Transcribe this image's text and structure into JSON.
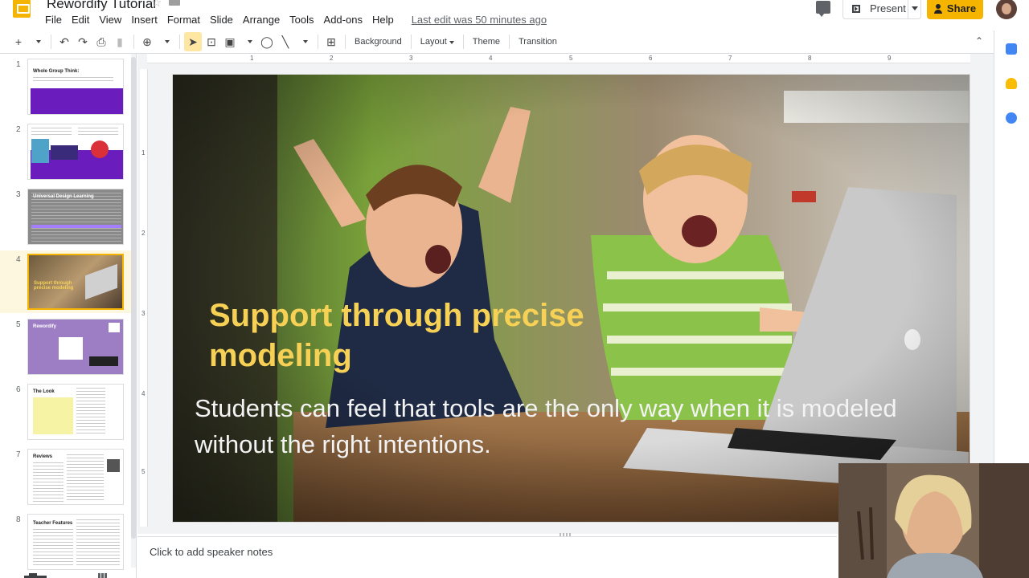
{
  "app": {
    "doc_title": "Rewordify Tutorial",
    "last_edit": "Last edit was 50 minutes ago"
  },
  "menu": [
    "File",
    "Edit",
    "View",
    "Insert",
    "Format",
    "Slide",
    "Arrange",
    "Tools",
    "Add-ons",
    "Help"
  ],
  "header": {
    "present_label": "Present",
    "share_label": "Share"
  },
  "toolbar": {
    "background_label": "Background",
    "layout_label": "Layout",
    "theme_label": "Theme",
    "transition_label": "Transition"
  },
  "ruler": {
    "horizontal": [
      "1",
      "2",
      "3",
      "4",
      "5",
      "6",
      "7",
      "8",
      "9"
    ],
    "vertical": [
      "1",
      "2",
      "3",
      "4",
      "5"
    ]
  },
  "filmstrip": {
    "slides": [
      {
        "number": "1",
        "title": "Whole Group Think:"
      },
      {
        "number": "2",
        "title": ""
      },
      {
        "number": "3",
        "title": "Universal Design Learning"
      },
      {
        "number": "4",
        "title": "Support through precise modeling"
      },
      {
        "number": "5",
        "title": "Rewordify"
      },
      {
        "number": "6",
        "title": "The Look"
      },
      {
        "number": "7",
        "title": "Reviews"
      },
      {
        "number": "8",
        "title": "Teacher Features"
      }
    ],
    "selected_index": 3
  },
  "slide": {
    "title": "Support through precise modeling",
    "body": "Students can feel that tools are the only way when it is modeled without the right intentions."
  },
  "notes": {
    "placeholder": "Click to add speaker notes"
  },
  "colors": {
    "accent": "#f4b400",
    "slide_title": "#f6d155",
    "thumb_purple": "#6a1cbd"
  }
}
